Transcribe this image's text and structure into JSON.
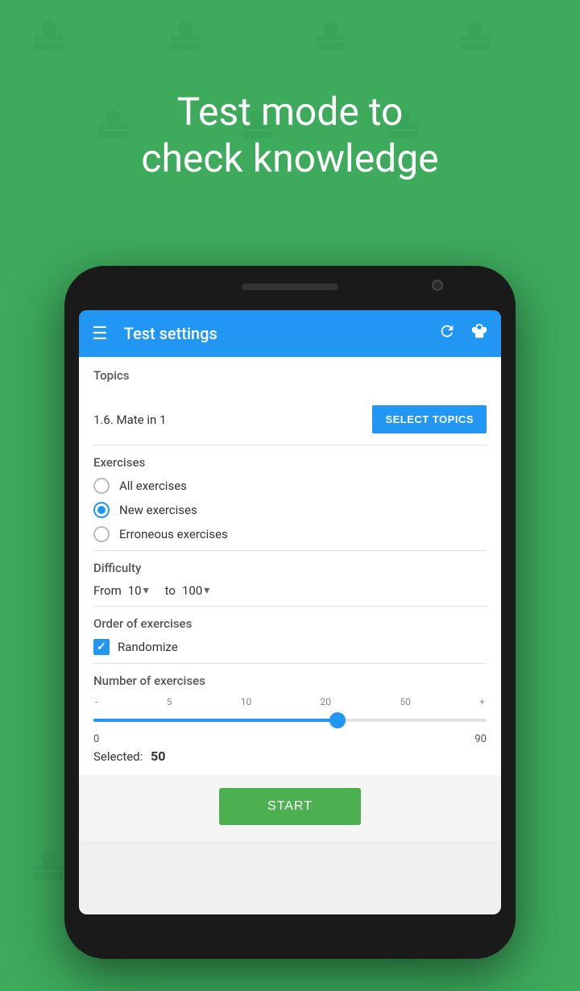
{
  "background": {
    "color": "#3daa5c"
  },
  "headline": {
    "line1": "Test mode to",
    "line2": "check knowledge"
  },
  "phone": {
    "appbar": {
      "title": "Test settings",
      "icon_menu": "☰",
      "icon_refresh": "↻",
      "icon_butterfly": "🦋"
    },
    "sections": {
      "topics": {
        "label": "Topics",
        "selected": "1.6. Mate in 1",
        "button": "SELECT TOPICS"
      },
      "exercises": {
        "label": "Exercises",
        "options": [
          {
            "id": "all",
            "label": "All exercises",
            "selected": false
          },
          {
            "id": "new",
            "label": "New exercises",
            "selected": true
          },
          {
            "id": "erroneous",
            "label": "Erroneous exercises",
            "selected": false
          }
        ]
      },
      "difficulty": {
        "label": "Difficulty",
        "from_label": "From",
        "from_value": "10",
        "to_label": "to",
        "to_value": "100"
      },
      "order": {
        "label": "Order of exercises",
        "checkbox_label": "Randomize",
        "checked": true
      },
      "number": {
        "label": "Number of exercises",
        "marks": [
          "-",
          "5",
          "10",
          "20",
          "50",
          "+"
        ],
        "min": "0",
        "max": "90",
        "selected_label": "Selected:",
        "selected_value": "50",
        "slider_percent": 62
      }
    },
    "start_button": "START"
  }
}
